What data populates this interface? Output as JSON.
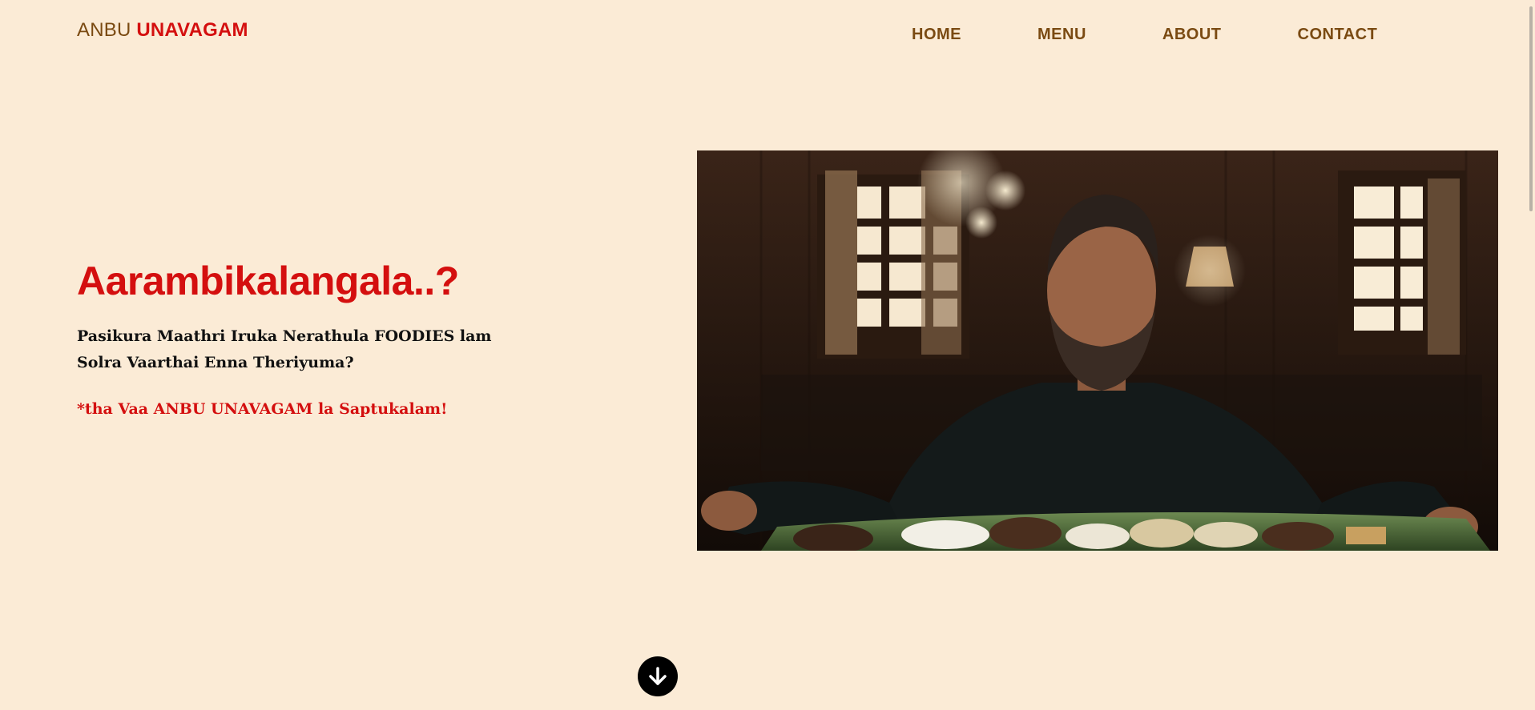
{
  "header": {
    "logo_light": "ANBU",
    "logo_strong": "UNAVAGAM"
  },
  "nav": {
    "items": [
      {
        "label": "HOME"
      },
      {
        "label": "MENU"
      },
      {
        "label": "ABOUT"
      },
      {
        "label": "CONTACT"
      }
    ]
  },
  "hero": {
    "title": "Aarambikalangala..?",
    "subtitle_line1": "Pasikura Maathri Iruka Nerathula FOODIES lam",
    "subtitle_line2": "Solra Vaarthai Enna Theriyuma?",
    "cta": "*tha Vaa ANBU UNAVAGAM la Saptukalam!",
    "image_icon": "photo-man-seated-at-banana-leaf-meal"
  },
  "scroll": {
    "icon": "arrow-down-icon"
  },
  "colors": {
    "background": "#fbebd6",
    "accent_red": "#d40f0f",
    "brown": "#7a4a12"
  }
}
